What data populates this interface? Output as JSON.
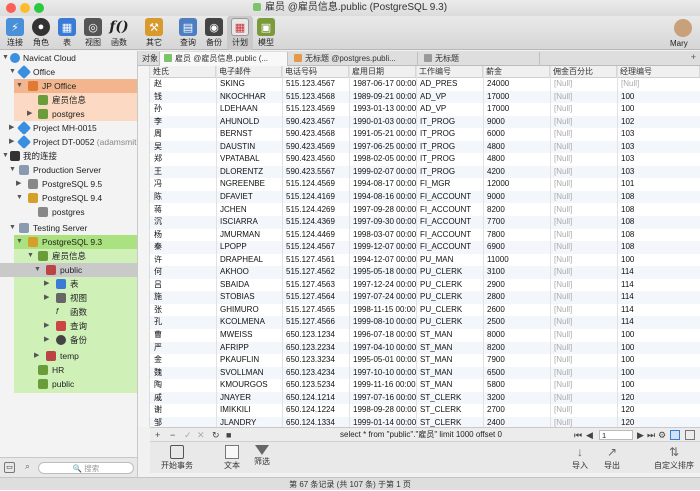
{
  "window": {
    "title": "雇员 @雇员信息.public (PostgreSQL 9.3)"
  },
  "toolbar": {
    "items": [
      {
        "label": "连接",
        "icon": "connection-icon"
      },
      {
        "label": "角色",
        "icon": "user-icon"
      },
      {
        "label": "表",
        "icon": "table-icon"
      },
      {
        "label": "视图",
        "icon": "view-icon"
      },
      {
        "label": "函数",
        "icon": "function-icon"
      },
      {
        "label": "其它",
        "icon": "tools-icon"
      },
      {
        "label": "查询",
        "icon": "query-icon"
      },
      {
        "label": "备份",
        "icon": "backup-icon"
      },
      {
        "label": "计划",
        "icon": "schedule-icon"
      },
      {
        "label": "模型",
        "icon": "model-icon"
      }
    ],
    "user": "Mary"
  },
  "sidebar": {
    "items": [
      {
        "label": "Navicat Cloud",
        "note": ""
      },
      {
        "label": "Office",
        "note": ""
      },
      {
        "label": "JP Office",
        "note": ""
      },
      {
        "label": "雇员信息",
        "note": ""
      },
      {
        "label": "postgres",
        "note": ""
      },
      {
        "label": "Project MH-0015",
        "note": ""
      },
      {
        "label": "Project DT-0052",
        "note": "(adamsmit..."
      },
      {
        "label": "我的连接",
        "note": ""
      },
      {
        "label": "Production Server",
        "note": ""
      },
      {
        "label": "PostgreSQL 9.5",
        "note": ""
      },
      {
        "label": "PostgreSQL 9.4",
        "note": ""
      },
      {
        "label": "postgres",
        "note": ""
      },
      {
        "label": "Testing Server",
        "note": ""
      },
      {
        "label": "PostgreSQL 9.3",
        "note": ""
      },
      {
        "label": "雇员信息",
        "note": ""
      },
      {
        "label": "public",
        "note": ""
      },
      {
        "label": "表",
        "note": ""
      },
      {
        "label": "视图",
        "note": ""
      },
      {
        "label": "函数",
        "note": ""
      },
      {
        "label": "查询",
        "note": ""
      },
      {
        "label": "备份",
        "note": ""
      },
      {
        "label": "temp",
        "note": ""
      },
      {
        "label": "HR",
        "note": ""
      },
      {
        "label": "public",
        "note": ""
      }
    ],
    "search_placeholder": "搜索"
  },
  "tabs": {
    "object": "对象",
    "items": [
      {
        "label": "雇员 @雇员信息.public (..."
      },
      {
        "label": "无标题 @postgres.publi..."
      },
      {
        "label": "无标题"
      }
    ]
  },
  "grid": {
    "columns": [
      "姓氏",
      "电子邮件",
      "电话号码",
      "雇用日期",
      "工作编号",
      "薪金",
      "佣金百分比",
      "经理编号"
    ],
    "rows": [
      [
        "赵",
        "SKING",
        "515.123.4567",
        "1987-06-17 00:00",
        "AD_PRES",
        "24000",
        "[Null]",
        "[Null]"
      ],
      [
        "钱",
        "NKOCHHAR",
        "515.123.4568",
        "1989-09-21 00:00",
        "AD_VP",
        "17000",
        "[Null]",
        "100"
      ],
      [
        "孙",
        "LDEHAAN",
        "515.123.4569",
        "1993-01-13 00:00",
        "AD_VP",
        "17000",
        "[Null]",
        "100"
      ],
      [
        "李",
        "AHUNOLD",
        "590.423.4567",
        "1990-01-03 00:00",
        "IT_PROG",
        "9000",
        "[Null]",
        "102"
      ],
      [
        "周",
        "BERNST",
        "590.423.4568",
        "1991-05-21 00:00",
        "IT_PROG",
        "6000",
        "[Null]",
        "103"
      ],
      [
        "吴",
        "DAUSTIN",
        "590.423.4569",
        "1997-06-25 00:00",
        "IT_PROG",
        "4800",
        "[Null]",
        "103"
      ],
      [
        "郑",
        "VPATABAL",
        "590.423.4560",
        "1998-02-05 00:00",
        "IT_PROG",
        "4800",
        "[Null]",
        "103"
      ],
      [
        "王",
        "DLORENTZ",
        "590.423.5567",
        "1999-02-07 00:00",
        "IT_PROG",
        "4200",
        "[Null]",
        "103"
      ],
      [
        "冯",
        "NGREENBE",
        "515.124.4569",
        "1994-08-17 00:00",
        "FI_MGR",
        "12000",
        "[Null]",
        "101"
      ],
      [
        "陈",
        "DFAVIET",
        "515.124.4169",
        "1994-08-16 00:00",
        "FI_ACCOUNT",
        "9000",
        "[Null]",
        "108"
      ],
      [
        "蒋",
        "JCHEN",
        "515.124.4269",
        "1997-09-28 00:00",
        "FI_ACCOUNT",
        "8200",
        "[Null]",
        "108"
      ],
      [
        "沉",
        "ISCIARRA",
        "515.124.4369",
        "1997-09-30 00:00",
        "FI_ACCOUNT",
        "7700",
        "[Null]",
        "108"
      ],
      [
        "杨",
        "JMURMAN",
        "515.124.4469",
        "1998-03-07 00:00",
        "FI_ACCOUNT",
        "7800",
        "[Null]",
        "108"
      ],
      [
        "秦",
        "LPOPP",
        "515.124.4567",
        "1999-12-07 00:00",
        "FI_ACCOUNT",
        "6900",
        "[Null]",
        "108"
      ],
      [
        "许",
        "DRAPHEAL",
        "515.127.4561",
        "1994-12-07 00:00",
        "PU_MAN",
        "11000",
        "[Null]",
        "100"
      ],
      [
        "何",
        "AKHOO",
        "515.127.4562",
        "1995-05-18 00:00",
        "PU_CLERK",
        "3100",
        "[Null]",
        "114"
      ],
      [
        "吕",
        "SBAIDA",
        "515.127.4563",
        "1997-12-24 00:00",
        "PU_CLERK",
        "2900",
        "[Null]",
        "114"
      ],
      [
        "施",
        "STOBIAS",
        "515.127.4564",
        "1997-07-24 00:00",
        "PU_CLERK",
        "2800",
        "[Null]",
        "114"
      ],
      [
        "张",
        "GHIMURO",
        "515.127.4565",
        "1998-11-15 00:00",
        "PU_CLERK",
        "2600",
        "[Null]",
        "114"
      ],
      [
        "孔",
        "KCOLMENA",
        "515.127.4566",
        "1999-08-10 00:00",
        "PU_CLERK",
        "2500",
        "[Null]",
        "114"
      ],
      [
        "曹",
        "MWEISS",
        "650.123.1234",
        "1996-07-18 00:00",
        "ST_MAN",
        "8000",
        "[Null]",
        "100"
      ],
      [
        "严",
        "AFRIPP",
        "650.123.2234",
        "1997-04-10 00:00",
        "ST_MAN",
        "8200",
        "[Null]",
        "100"
      ],
      [
        "金",
        "PKAUFLIN",
        "650.123.3234",
        "1995-05-01 00:00",
        "ST_MAN",
        "7900",
        "[Null]",
        "100"
      ],
      [
        "魏",
        "SVOLLMAN",
        "650.123.4234",
        "1997-10-10 00:00",
        "ST_MAN",
        "6500",
        "[Null]",
        "100"
      ],
      [
        "陶",
        "KMOURGOS",
        "650.123.5234",
        "1999-11-16 00:00",
        "ST_MAN",
        "5800",
        "[Null]",
        "100"
      ],
      [
        "戚",
        "JNAYER",
        "650.124.1214",
        "1997-07-16 00:00",
        "ST_CLERK",
        "3200",
        "[Null]",
        "120"
      ],
      [
        "谢",
        "IMIKKILI",
        "650.124.1224",
        "1998-09-28 00:00",
        "ST_CLERK",
        "2700",
        "[Null]",
        "120"
      ],
      [
        "邹",
        "JLANDRY",
        "650.124.1334",
        "1999-01-14 00:00",
        "ST_CLERK",
        "2400",
        "[Null]",
        "120"
      ]
    ]
  },
  "status": {
    "sql": "select * from \"public\".\"雇员\" limit 1000 offset 0",
    "page": "1",
    "footer": "第 67 条记录 (共 107 条) 于第 1 页"
  },
  "actions": {
    "begin_transaction": "开始事务",
    "text": "文本",
    "filter": "筛选",
    "import": "导入",
    "export": "导出",
    "custom_sort": "自定义排序"
  },
  "colors": {
    "sidebar_selected_orange": "#f6c7a6",
    "sidebar_selected_green": "#c8efb0",
    "grid_alt_row": "#f3f6fb"
  }
}
